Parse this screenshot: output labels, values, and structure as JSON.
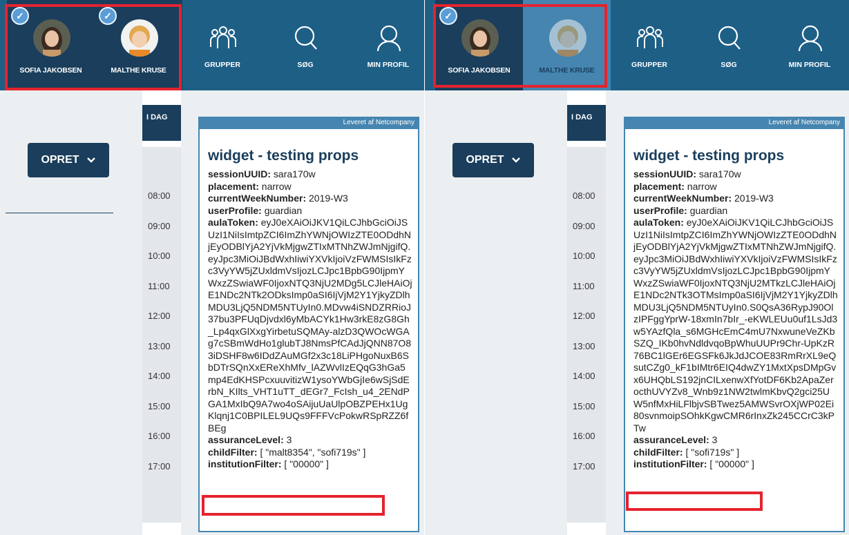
{
  "colors": {
    "accent_red": "#e5232e",
    "navy": "#1a3e5c",
    "topbar": "#1e5f86",
    "widget_border": "#4585b0"
  },
  "panels": [
    {
      "children": [
        {
          "name": "SOFIA JAKOBSEN",
          "checked": true,
          "state": "active",
          "icon": "check-icon"
        },
        {
          "name": "MALTHE KRUSE",
          "checked": true,
          "state": "active",
          "icon": "check-icon"
        }
      ],
      "nav": [
        {
          "label": "GRUPPER",
          "icon": "groups-icon"
        },
        {
          "label": "SØG",
          "icon": "search-icon"
        },
        {
          "label": "MIN PROFIL",
          "icon": "profile-icon"
        }
      ],
      "opret_label": "OPRET",
      "idag_label": "I DAG",
      "times": [
        "08:00",
        "09:00",
        "10:00",
        "11:00",
        "12:00",
        "13:00",
        "14:00",
        "15:00",
        "16:00",
        "17:00"
      ],
      "widget": {
        "provider": "Leveret af Netcompany",
        "title": "widget - testing props",
        "props": [
          {
            "key": "sessionUUID:",
            "value": " sara170w"
          },
          {
            "key": "placement:",
            "value": " narrow"
          },
          {
            "key": "currentWeekNumber:",
            "value": " 2019-W3"
          },
          {
            "key": "userProfile:",
            "value": " guardian"
          }
        ],
        "aula_key": "aulaToken:",
        "aula_value": " eyJ0eXAiOiJKV1QiLCJhbGciOiJSUzI1NiIsImtpZCI6ImZhYWNjOWIzZTE0ODdhNjEyODBlYjA2YjVkMjgwZTIxMTNhZWJmNjgifQ.eyJpc3MiOiJBdWxhIiwiYXVkIjoiVzFWMSIsIkFzc3VyYW5jZUxldmVsIjozLCJpc1BpbG90IjpmYWxzZSwiaWF0IjoxNTQ3NjU2MDg5LCJleHAiOjE1NDc2NTk2ODksImp0aSI6IjVjM2Y1YjkyZDlhMDU3LjQ5NDM5NTUyIn0.MDvw4iSNDZRRioJ37bu3PFUqDjvdxl6yMbACYk1Hw3rkE8zG8Gh_Lp4qxGlXxgYirbetuSQMAy-alzD3QWOcWGAg7cSBmWdHo1glubTJ8NmsPfCAdJjQNN87O83iDSHF8w6IDdZAuMGf2x3c18LiPHgoNuxB6SbDTrSQnXxEReXhMfv_lAZWvlIzEQqG3hGa5mp4EdKHSPcxuuvitizW1ysoYWbGjIe6wSjSdErbN_KIlts_VHT1uTT_dEGr7_FcIsh_u4_2ENdPGA1MxIbQ9A7wo4oSAijuUaUlpOBZPEHx1UgKlqnj1C0BPILEL9UQs9FFFVcPokwRSpRZZ6fBEg",
        "assurance_key": "assuranceLevel:",
        "assurance_value": " 3",
        "child_filter_key": "childFilter:",
        "child_filter_value": " [ \"malt8354\", \"sofi719s\" ]",
        "institution_key": "institutionFilter:",
        "institution_value": " [ \"00000\" ]"
      }
    },
    {
      "children": [
        {
          "name": "SOFIA JAKOBSEN",
          "checked": true,
          "state": "active",
          "icon": "check-icon"
        },
        {
          "name": "MALTHE KRUSE",
          "checked": false,
          "state": "inactive",
          "icon": ""
        }
      ],
      "nav": [
        {
          "label": "GRUPPER",
          "icon": "groups-icon"
        },
        {
          "label": "SØG",
          "icon": "search-icon"
        },
        {
          "label": "MIN PROFIL",
          "icon": "profile-icon"
        }
      ],
      "opret_label": "OPRET",
      "idag_label": "I DAG",
      "times": [
        "08:00",
        "09:00",
        "10:00",
        "11:00",
        "12:00",
        "13:00",
        "14:00",
        "15:00",
        "16:00",
        "17:00"
      ],
      "widget": {
        "provider": "Leveret af Netcompany",
        "title": "widget - testing props",
        "props": [
          {
            "key": "sessionUUID:",
            "value": " sara170w"
          },
          {
            "key": "placement:",
            "value": " narrow"
          },
          {
            "key": "currentWeekNumber:",
            "value": " 2019-W3"
          },
          {
            "key": "userProfile:",
            "value": " guardian"
          }
        ],
        "aula_key": "aulaToken:",
        "aula_value": " eyJ0eXAiOiJKV1QiLCJhbGciOiJSUzI1NiIsImtpZCI6ImZhYWNjOWIzZTE0ODdhNjEyODBlYjA2YjVkMjgwZTIxMTNhZWJmNjgifQ.eyJpc3MiOiJBdWxhIiwiYXVkIjoiVzFWMSIsIkFzc3VyYW5jZUxldmVsIjozLCJpc1BpbG90IjpmYWxzZSwiaWF0IjoxNTQ3NjU2MTkzLCJleHAiOjE1NDc2NTk3OTMsImp0aSI6IjVjM2Y1YjkyZDlhMDU3LjQ5NDM5NTUyIn0.S0QsA36RypJ90OlzIPFggYprW-18xmIn7bIr_-eKWLEUu0uf1LsJd3w5YAzfQla_s6MGHcEmC4mU7NxwuneVeZKbSZQ_IKb0hvNdldvqoBpWhuUUPr9Chr-UpKzR76BC1lGEr6EGSFk6JkJdJCOE83RmRrXL9eQsutCZg0_kF1bIMtr6EIQ4dwZY1MxtXpsDMpGvx6UHQbLS192jnCILxenwXfYotDF6Kb2ApaZerocthUVYZv8_Wnb9z1NW2twlmKbvQ2gci25UW5nfMxHiLFlbjvSBTwez5AMWSvrOXjWP02Ei80svnmoipSOhkKgwCMR6rInxZk245CCrC3kPTw",
        "assurance_key": "assuranceLevel:",
        "assurance_value": " 3",
        "child_filter_key": "childFilter:",
        "child_filter_value": " [ \"sofi719s\" ]",
        "institution_key": "institutionFilter:",
        "institution_value": " [ \"00000\" ]"
      }
    }
  ]
}
